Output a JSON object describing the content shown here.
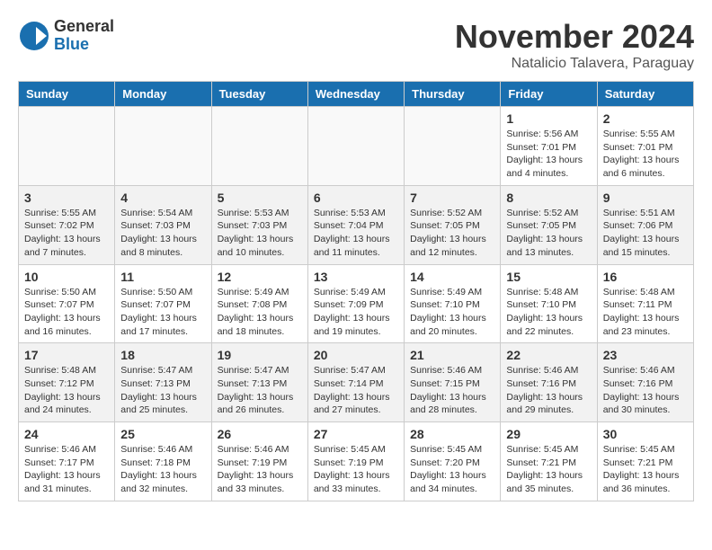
{
  "header": {
    "logo_line1": "General",
    "logo_line2": "Blue",
    "month": "November 2024",
    "location": "Natalicio Talavera, Paraguay"
  },
  "days_of_week": [
    "Sunday",
    "Monday",
    "Tuesday",
    "Wednesday",
    "Thursday",
    "Friday",
    "Saturday"
  ],
  "weeks": [
    [
      {
        "day": "",
        "info": ""
      },
      {
        "day": "",
        "info": ""
      },
      {
        "day": "",
        "info": ""
      },
      {
        "day": "",
        "info": ""
      },
      {
        "day": "",
        "info": ""
      },
      {
        "day": "1",
        "info": "Sunrise: 5:56 AM\nSunset: 7:01 PM\nDaylight: 13 hours and 4 minutes."
      },
      {
        "day": "2",
        "info": "Sunrise: 5:55 AM\nSunset: 7:01 PM\nDaylight: 13 hours and 6 minutes."
      }
    ],
    [
      {
        "day": "3",
        "info": "Sunrise: 5:55 AM\nSunset: 7:02 PM\nDaylight: 13 hours and 7 minutes."
      },
      {
        "day": "4",
        "info": "Sunrise: 5:54 AM\nSunset: 7:03 PM\nDaylight: 13 hours and 8 minutes."
      },
      {
        "day": "5",
        "info": "Sunrise: 5:53 AM\nSunset: 7:03 PM\nDaylight: 13 hours and 10 minutes."
      },
      {
        "day": "6",
        "info": "Sunrise: 5:53 AM\nSunset: 7:04 PM\nDaylight: 13 hours and 11 minutes."
      },
      {
        "day": "7",
        "info": "Sunrise: 5:52 AM\nSunset: 7:05 PM\nDaylight: 13 hours and 12 minutes."
      },
      {
        "day": "8",
        "info": "Sunrise: 5:52 AM\nSunset: 7:05 PM\nDaylight: 13 hours and 13 minutes."
      },
      {
        "day": "9",
        "info": "Sunrise: 5:51 AM\nSunset: 7:06 PM\nDaylight: 13 hours and 15 minutes."
      }
    ],
    [
      {
        "day": "10",
        "info": "Sunrise: 5:50 AM\nSunset: 7:07 PM\nDaylight: 13 hours and 16 minutes."
      },
      {
        "day": "11",
        "info": "Sunrise: 5:50 AM\nSunset: 7:07 PM\nDaylight: 13 hours and 17 minutes."
      },
      {
        "day": "12",
        "info": "Sunrise: 5:49 AM\nSunset: 7:08 PM\nDaylight: 13 hours and 18 minutes."
      },
      {
        "day": "13",
        "info": "Sunrise: 5:49 AM\nSunset: 7:09 PM\nDaylight: 13 hours and 19 minutes."
      },
      {
        "day": "14",
        "info": "Sunrise: 5:49 AM\nSunset: 7:10 PM\nDaylight: 13 hours and 20 minutes."
      },
      {
        "day": "15",
        "info": "Sunrise: 5:48 AM\nSunset: 7:10 PM\nDaylight: 13 hours and 22 minutes."
      },
      {
        "day": "16",
        "info": "Sunrise: 5:48 AM\nSunset: 7:11 PM\nDaylight: 13 hours and 23 minutes."
      }
    ],
    [
      {
        "day": "17",
        "info": "Sunrise: 5:48 AM\nSunset: 7:12 PM\nDaylight: 13 hours and 24 minutes."
      },
      {
        "day": "18",
        "info": "Sunrise: 5:47 AM\nSunset: 7:13 PM\nDaylight: 13 hours and 25 minutes."
      },
      {
        "day": "19",
        "info": "Sunrise: 5:47 AM\nSunset: 7:13 PM\nDaylight: 13 hours and 26 minutes."
      },
      {
        "day": "20",
        "info": "Sunrise: 5:47 AM\nSunset: 7:14 PM\nDaylight: 13 hours and 27 minutes."
      },
      {
        "day": "21",
        "info": "Sunrise: 5:46 AM\nSunset: 7:15 PM\nDaylight: 13 hours and 28 minutes."
      },
      {
        "day": "22",
        "info": "Sunrise: 5:46 AM\nSunset: 7:16 PM\nDaylight: 13 hours and 29 minutes."
      },
      {
        "day": "23",
        "info": "Sunrise: 5:46 AM\nSunset: 7:16 PM\nDaylight: 13 hours and 30 minutes."
      }
    ],
    [
      {
        "day": "24",
        "info": "Sunrise: 5:46 AM\nSunset: 7:17 PM\nDaylight: 13 hours and 31 minutes."
      },
      {
        "day": "25",
        "info": "Sunrise: 5:46 AM\nSunset: 7:18 PM\nDaylight: 13 hours and 32 minutes."
      },
      {
        "day": "26",
        "info": "Sunrise: 5:46 AM\nSunset: 7:19 PM\nDaylight: 13 hours and 33 minutes."
      },
      {
        "day": "27",
        "info": "Sunrise: 5:45 AM\nSunset: 7:19 PM\nDaylight: 13 hours and 33 minutes."
      },
      {
        "day": "28",
        "info": "Sunrise: 5:45 AM\nSunset: 7:20 PM\nDaylight: 13 hours and 34 minutes."
      },
      {
        "day": "29",
        "info": "Sunrise: 5:45 AM\nSunset: 7:21 PM\nDaylight: 13 hours and 35 minutes."
      },
      {
        "day": "30",
        "info": "Sunrise: 5:45 AM\nSunset: 7:21 PM\nDaylight: 13 hours and 36 minutes."
      }
    ]
  ]
}
